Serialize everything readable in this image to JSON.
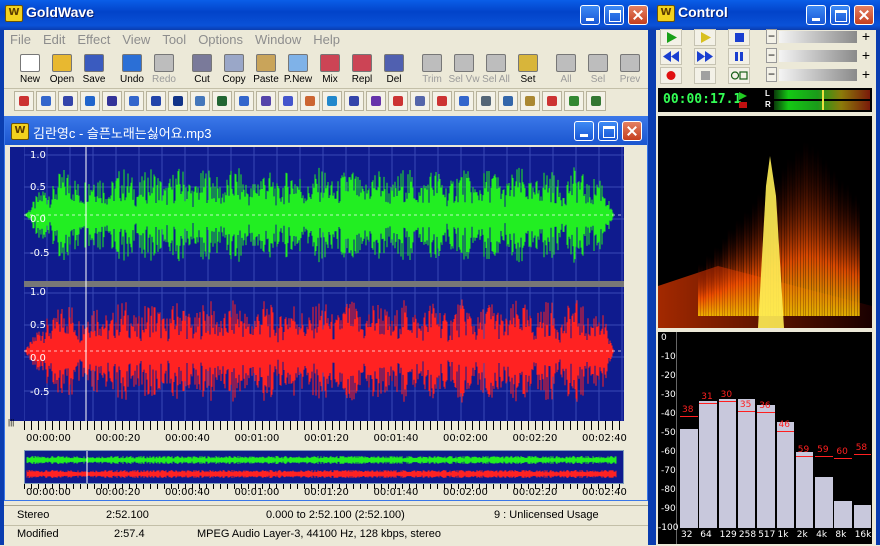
{
  "main_window": {
    "title": "GoldWave",
    "logo": "W",
    "menu": [
      "File",
      "Edit",
      "Effect",
      "View",
      "Tool",
      "Options",
      "Window",
      "Help"
    ]
  },
  "toolbar1": [
    {
      "label": "New",
      "icon": "new-icon",
      "color": "#ffffff",
      "enabled": true
    },
    {
      "label": "Open",
      "icon": "open-icon",
      "color": "#e8b830",
      "enabled": true
    },
    {
      "label": "Save",
      "icon": "save-icon",
      "color": "#3a5bbf",
      "enabled": true
    },
    {
      "label": "Undo",
      "icon": "undo-icon",
      "color": "#2b6fd6",
      "enabled": true
    },
    {
      "label": "Redo",
      "icon": "redo-icon",
      "color": "#bdbdbd",
      "enabled": false
    },
    {
      "label": "Cut",
      "icon": "cut-icon",
      "color": "#7a7a9a",
      "enabled": true
    },
    {
      "label": "Copy",
      "icon": "copy-icon",
      "color": "#9aa7c8",
      "enabled": true
    },
    {
      "label": "Paste",
      "icon": "paste-icon",
      "color": "#c9a45a",
      "enabled": true
    },
    {
      "label": "P.New",
      "icon": "paste-new-icon",
      "color": "#7fb2e8",
      "enabled": true
    },
    {
      "label": "Mix",
      "icon": "mix-icon",
      "color": "#cc4455",
      "enabled": true
    },
    {
      "label": "Repl",
      "icon": "replace-icon",
      "color": "#cc4455",
      "enabled": true
    },
    {
      "label": "Del",
      "icon": "delete-icon",
      "color": "#5060b0",
      "enabled": true
    },
    {
      "label": "Trim",
      "icon": "trim-icon",
      "color": "#bdbdbd",
      "enabled": false
    },
    {
      "label": "Sel Vw",
      "icon": "select-view-icon",
      "color": "#bdbdbd",
      "enabled": false
    },
    {
      "label": "Sel All",
      "icon": "select-all-icon",
      "color": "#bdbdbd",
      "enabled": false
    },
    {
      "label": "Set",
      "icon": "set-icon",
      "color": "#d8b53a",
      "enabled": true
    },
    {
      "label": "All",
      "icon": "zoom-all-icon",
      "color": "#bdbdbd",
      "enabled": false
    },
    {
      "label": "Sel",
      "icon": "zoom-sel-icon",
      "color": "#bdbdbd",
      "enabled": false
    },
    {
      "label": "Prev",
      "icon": "zoom-prev-icon",
      "color": "#bdbdbd",
      "enabled": false
    }
  ],
  "toolbar2_colors": [
    "#cc3333",
    "#3366cc",
    "#3344aa",
    "#2266cc",
    "#333399",
    "#3366cc",
    "#2244aa",
    "#113388",
    "#4477bb",
    "#226633",
    "#3366cc",
    "#5544aa",
    "#4455cc",
    "#cc6633",
    "#2288cc",
    "#3344aa",
    "#6633aa",
    "#cc3333",
    "#5566aa",
    "#cc3333",
    "#3366cc",
    "#556677",
    "#3366aa",
    "#aa8833",
    "#cc3333",
    "#338833",
    "#337733"
  ],
  "document": {
    "title": "김란영c - 슬픈노래는싫어요.mp3",
    "logo": "W",
    "y_labels": [
      "1.0",
      "0.5",
      "0.0",
      "-0.5"
    ],
    "time_labels": [
      "00:00:00",
      "00:00:20",
      "00:00:40",
      "00:01:00",
      "00:01:20",
      "00:01:40",
      "00:02:00",
      "00:02:20",
      "00:02:40"
    ],
    "left_color": "#22ee22",
    "right_color": "#ff2222"
  },
  "status": {
    "row1": {
      "channels": "Stereo",
      "length": "2:52.100",
      "selection": "0.000 to 2:52.100 (2:52.100)",
      "license": "9 : Unlicensed Usage"
    },
    "row2": {
      "state": "Modified",
      "position": "2:57.4",
      "format": "MPEG Audio Layer-3, 44100 Hz, 128 kbps, stereo"
    }
  },
  "control": {
    "title": "Control",
    "time": "00:00:17.1",
    "meter_labels": [
      "L",
      "R"
    ],
    "eq_ticks": [
      "0",
      "-10",
      "-20",
      "-30",
      "-40",
      "-50",
      "-60",
      "-70",
      "-80",
      "-90",
      "-100"
    ],
    "eq_bands": [
      "32",
      "64",
      "129",
      "258",
      "517",
      "1k",
      "2k",
      "4k",
      "8k",
      "16k"
    ],
    "eq_values": [
      -38,
      -31,
      -30,
      -35,
      -36,
      -46,
      -59,
      -59,
      -60,
      -58
    ],
    "eq_bar_levels": [
      -48,
      -33,
      -32,
      -32,
      -35,
      -44,
      -60,
      -73,
      -86,
      -88
    ]
  }
}
